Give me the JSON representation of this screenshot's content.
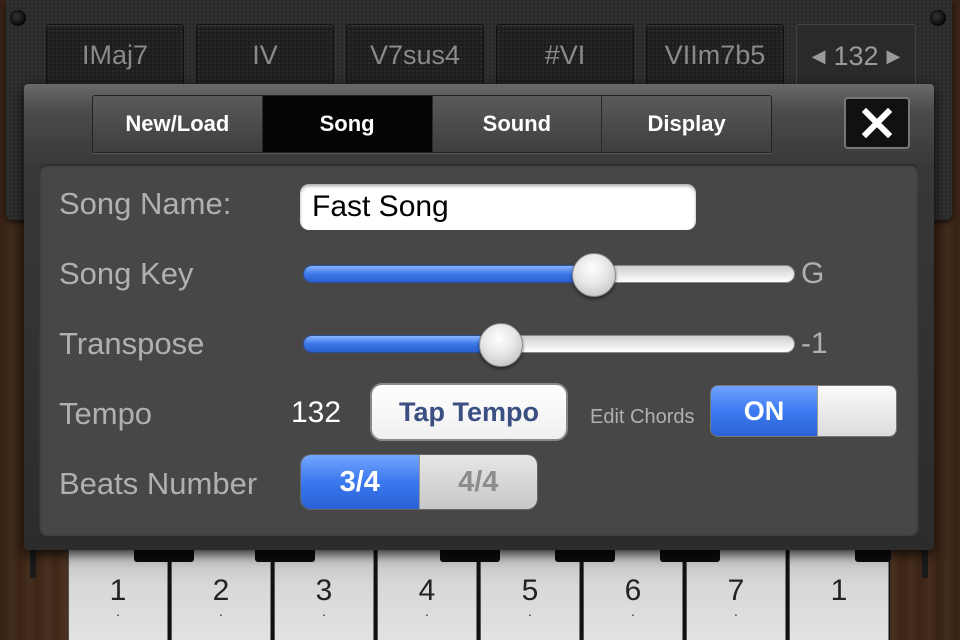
{
  "chord_bar": {
    "chords": [
      "IMaj7",
      "IV",
      "V7sus4",
      "#VI",
      "VIIm7b5"
    ],
    "tempo_display": "132",
    "prev_icon": "triangle-left-icon",
    "next_icon": "triangle-right-icon"
  },
  "panel": {
    "tabs": [
      {
        "label": "New/Load",
        "active": false
      },
      {
        "label": "Song",
        "active": true
      },
      {
        "label": "Sound",
        "active": false
      },
      {
        "label": "Display",
        "active": false
      }
    ],
    "close_icon": "close-x-icon"
  },
  "song_settings": {
    "song_name_label": "Song Name:",
    "song_name_value": "Fast Song",
    "song_key_label": "Song Key",
    "song_key_value": "G",
    "song_key_position": 0.59,
    "transpose_label": "Transpose",
    "transpose_value": "-1",
    "transpose_position": 0.4,
    "tempo_label": "Tempo",
    "tempo_value": "132",
    "tap_tempo_label": "Tap Tempo",
    "edit_chords_label": "Edit Chords",
    "edit_chords_state": "ON",
    "beats_label": "Beats Number",
    "beats_options": [
      "3/4",
      "4/4"
    ],
    "beats_selected": "3/4"
  },
  "keyboard": {
    "keys": [
      "1",
      "2",
      "3",
      "4",
      "5",
      "6",
      "7",
      "1"
    ]
  },
  "colors": {
    "accent_blue": "#3c78e8",
    "tap_text": "#3b4f82",
    "panel_body": "#474747"
  }
}
